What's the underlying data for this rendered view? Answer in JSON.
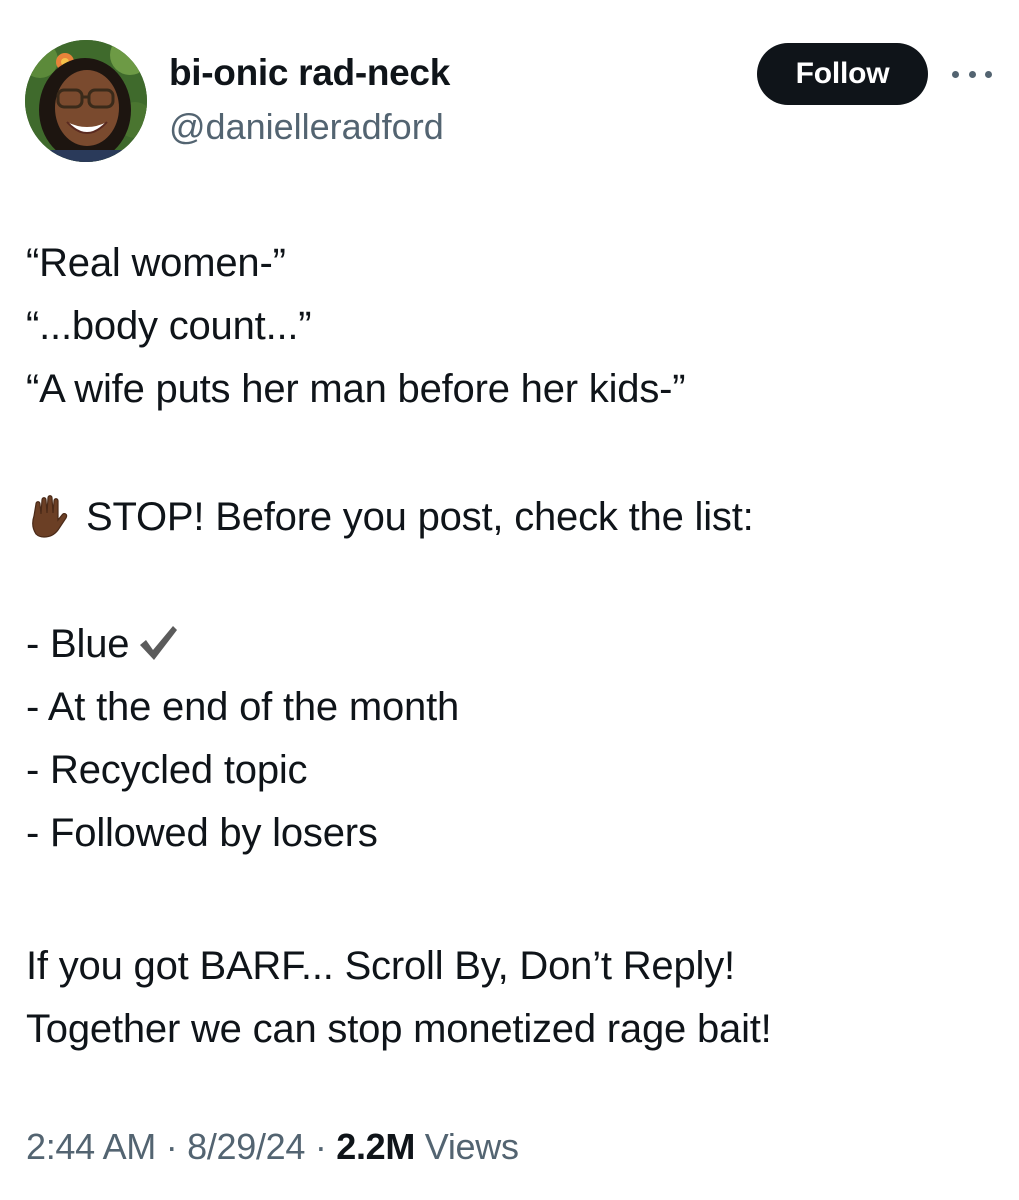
{
  "author": {
    "display_name": "bi-onic rad-neck",
    "handle": "@danielleradford",
    "avatar_icon": "profile-photo"
  },
  "header": {
    "follow_label": "Follow",
    "more_icon": "ellipsis-icon"
  },
  "tweet": {
    "quotes": [
      "“Real women-”",
      "“...body count...”",
      "“A wife puts her man before her kids-”"
    ],
    "stop_icon": "raised-hand-emoji",
    "stop_line": "STOP! Before you post, check the list:",
    "list_items": [
      "- Blue",
      "- At the end of the month",
      "- Recycled topic",
      "- Followed by losers"
    ],
    "check_icon": "check-mark-icon",
    "closing_lines": [
      "If you got BARF... Scroll By, Don’t Reply!",
      "Together we can stop monetized rage bait!"
    ]
  },
  "meta": {
    "time": "2:44 AM",
    "separator": "·",
    "date": "8/29/24",
    "views_count": "2.2M",
    "views_label": "Views"
  },
  "colors": {
    "text_primary": "#0f1419",
    "text_secondary": "#536471",
    "follow_bg": "#0f1419",
    "follow_text": "#ffffff"
  }
}
